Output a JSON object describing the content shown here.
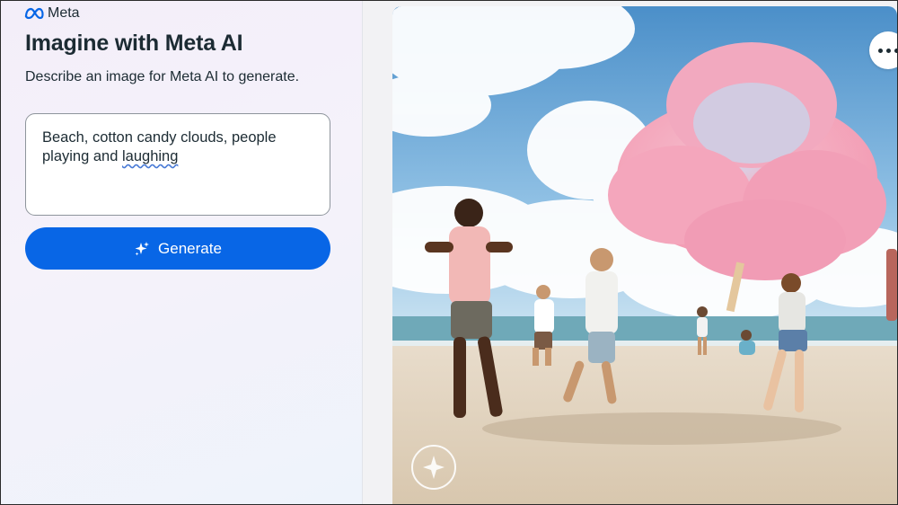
{
  "brand": {
    "name": "Meta",
    "icon": "meta-infinity-logo"
  },
  "header": {
    "title": "Imagine with Meta AI",
    "subtitle": "Describe an image for Meta AI to generate."
  },
  "prompt": {
    "text_before": "Beach, cotton candy clouds, people playing and ",
    "text_misspelled": "laughing"
  },
  "generate_button": {
    "label": "Generate",
    "icon": "sparkle-icon"
  },
  "image": {
    "description_icon": "generated-image",
    "watermark_icon": "imagined-with-ai-watermark",
    "more_icon": "more-options-icon"
  },
  "colors": {
    "accent": "#0866e6",
    "text": "#1c2b33"
  }
}
